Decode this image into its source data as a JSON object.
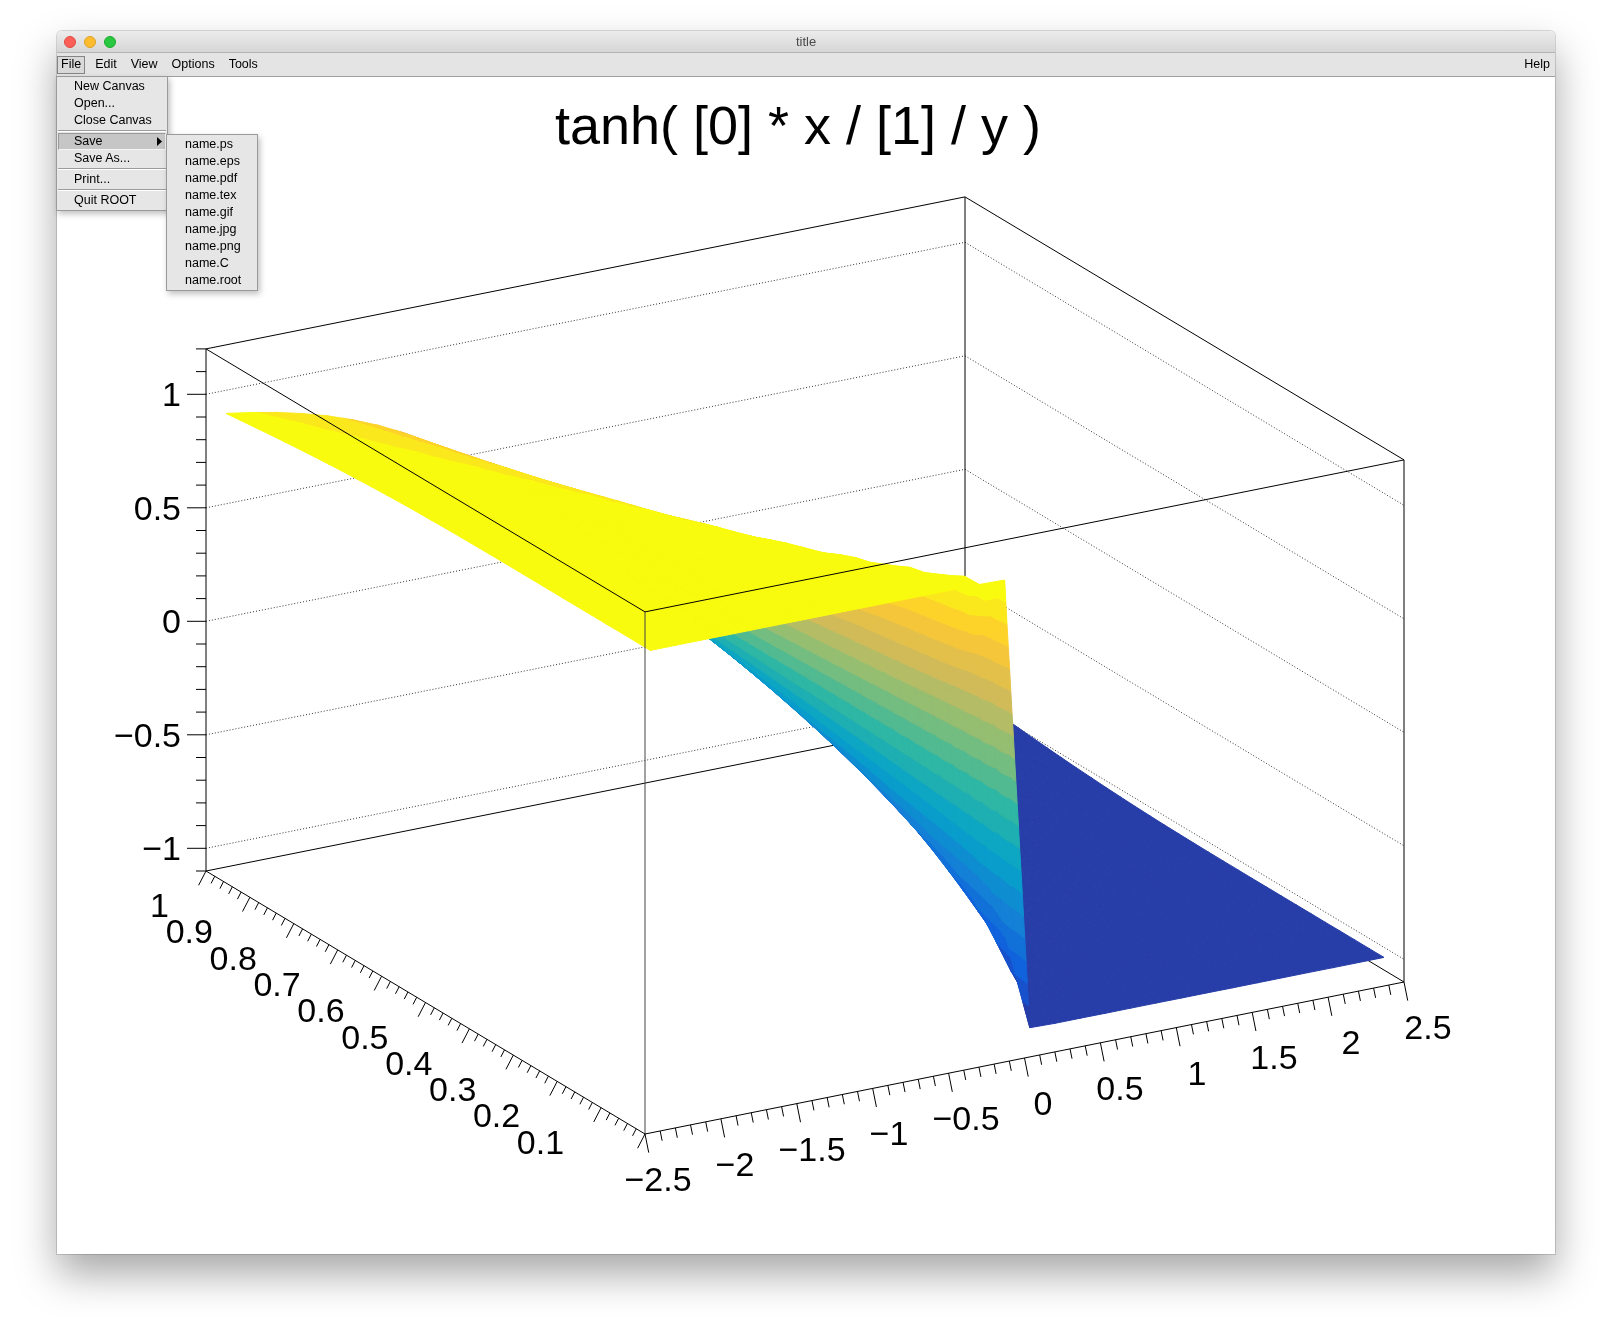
{
  "window": {
    "title": "title"
  },
  "menubar": {
    "items": [
      {
        "label": "File",
        "selected": true
      },
      {
        "label": "Edit",
        "selected": false
      },
      {
        "label": "View",
        "selected": false
      },
      {
        "label": "Options",
        "selected": false
      },
      {
        "label": "Tools",
        "selected": false
      }
    ],
    "help": {
      "label": "Help",
      "selected": false
    }
  },
  "file_menu": {
    "items": [
      {
        "kind": "item",
        "label": "New Canvas",
        "selected": false
      },
      {
        "kind": "item",
        "label": "Open...",
        "selected": false
      },
      {
        "kind": "item",
        "label": "Close Canvas",
        "selected": false
      },
      {
        "kind": "separator"
      },
      {
        "kind": "item",
        "label": "Save",
        "selected": true,
        "submenu": true
      },
      {
        "kind": "item",
        "label": "Save As...",
        "selected": false
      },
      {
        "kind": "separator"
      },
      {
        "kind": "item",
        "label": "Print...",
        "selected": false
      },
      {
        "kind": "separator"
      },
      {
        "kind": "item",
        "label": "Quit ROOT",
        "selected": false
      }
    ]
  },
  "save_submenu": {
    "items": [
      {
        "label": "name.ps",
        "selected": false
      },
      {
        "label": "name.eps",
        "selected": false
      },
      {
        "label": "name.pdf",
        "selected": false
      },
      {
        "label": "name.tex",
        "selected": false
      },
      {
        "label": "name.gif",
        "selected": false
      },
      {
        "label": "name.jpg",
        "selected": false
      },
      {
        "label": "name.png",
        "selected": false
      },
      {
        "label": "name.C",
        "selected": false
      },
      {
        "label": "name.root",
        "selected": false
      }
    ]
  },
  "canvas": {
    "title": "tanh( [0] * x / [1] / y )",
    "z_axis": {
      "ticks": [
        "1",
        "0.5",
        "0",
        "−0.5",
        "−1"
      ]
    },
    "y_axis": {
      "ticks": [
        "1",
        "0.9",
        "0.8",
        "0.7",
        "0.6",
        "0.5",
        "0.4",
        "0.3",
        "0.2",
        "0.1"
      ]
    },
    "x_axis": {
      "ticks": [
        "−2.5",
        "−2",
        "−1.5",
        "−1",
        "−0.5",
        "0",
        "0.5",
        "1",
        "1.5",
        "2",
        "2.5"
      ]
    }
  }
}
